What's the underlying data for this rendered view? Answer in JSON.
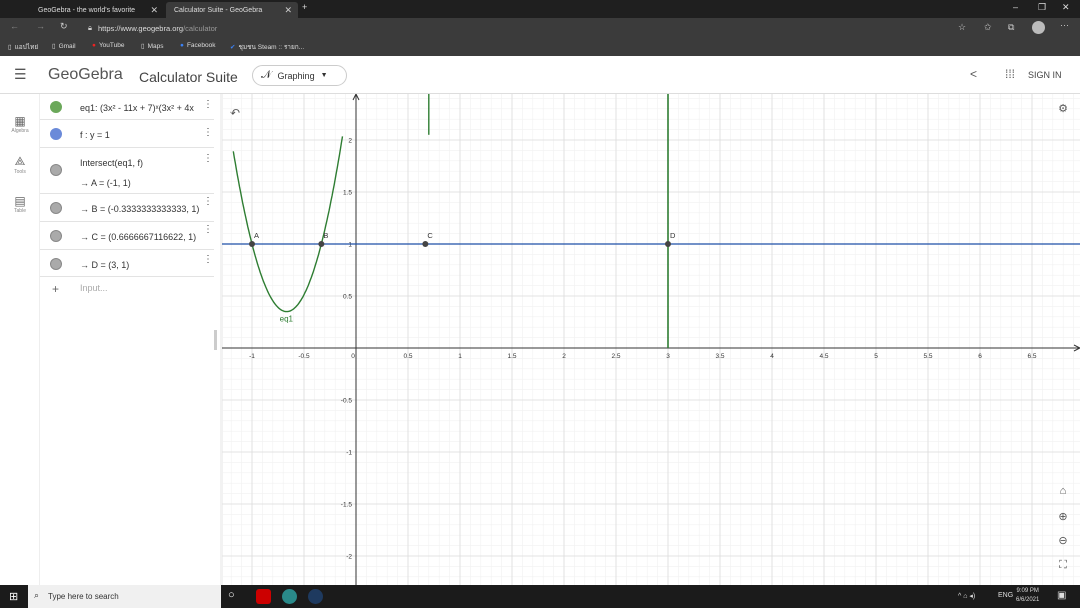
{
  "browser": {
    "tabs": [
      {
        "label": "GeoGebra - the world's favorite",
        "active": false
      },
      {
        "label": "Calculator Suite - GeoGebra",
        "active": true
      }
    ],
    "new_tab": "+",
    "url_host": "https://www.geogebra.org",
    "url_path": "/calculator",
    "bookmarks": [
      "แอปไทย่",
      "Gmail",
      "YouTube",
      "Maps",
      "Facebook",
      "ชุมชน Steam :: รายก..."
    ]
  },
  "header": {
    "brand": "GeoGebra",
    "suite": "Calculator Suite",
    "app_switch": "Graphing",
    "sign_in": "SIGN IN"
  },
  "rail": {
    "items": [
      "Algebra",
      "Tools",
      "Table"
    ]
  },
  "algebra": {
    "rows": [
      {
        "text": "eq1: (3x² - 11x + 7)ˣ(3x² + 4x",
        "color": "#6ba85a"
      },
      {
        "text": "f : y = 1",
        "color": "#6b8ad9"
      },
      {
        "text": "Intersect(eq1, f)",
        "color": "#aaaaaa"
      },
      {
        "text": "→ A = (-1, 1)",
        "color": "#aaaaaa"
      },
      {
        "text": "→ B = (-0.3333333333333, 1)",
        "color": "#aaaaaa"
      },
      {
        "text": "→ C = (0.6666667116622, 1)",
        "color": "#aaaaaa"
      },
      {
        "text": "→ D = (3, 1)",
        "color": "#aaaaaa"
      }
    ],
    "input_placeholder": "Input..."
  },
  "graph": {
    "x_ticks": [
      "-1",
      "-0.5",
      "0",
      "0.5",
      "1",
      "1.5",
      "2",
      "2.5",
      "3",
      "3.5",
      "4",
      "4.5",
      "5",
      "5.5",
      "6",
      "6.5"
    ],
    "y_ticks": [
      "2",
      "1.5",
      "1",
      "0.5",
      "-0.5",
      "-1",
      "-1.5",
      "-2"
    ],
    "points": [
      {
        "label": "A",
        "x": -1,
        "y": 1
      },
      {
        "label": "B",
        "x": -0.3333,
        "y": 1
      },
      {
        "label": "C",
        "x": 0.6667,
        "y": 1
      },
      {
        "label": "D",
        "x": 3,
        "y": 1
      }
    ],
    "curve_label": "eq1",
    "colors": {
      "curve": "#2e7d32",
      "line": "#1e4fa8",
      "point": "#444444"
    }
  },
  "taskbar": {
    "search_placeholder": "Type here to search",
    "lang": "ENG",
    "time": "9:09 PM",
    "date": "6/6/2021"
  }
}
